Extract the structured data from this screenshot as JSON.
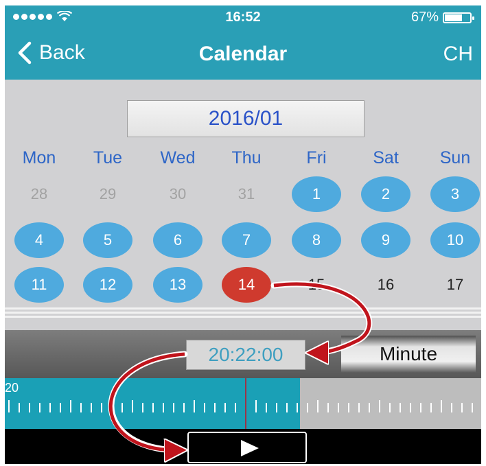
{
  "status_bar": {
    "signal_dots": 5,
    "time": "16:52",
    "battery_percent": "67%",
    "battery_level": 0.67
  },
  "nav": {
    "back_label": "Back",
    "title": "Calendar",
    "right_label": "CH"
  },
  "calendar": {
    "month": "2016/01",
    "weekdays": [
      "Mon",
      "Tue",
      "Wed",
      "Thu",
      "Fri",
      "Sat",
      "Sun"
    ],
    "weeks": [
      [
        {
          "d": "28",
          "s": "muted"
        },
        {
          "d": "29",
          "s": "muted"
        },
        {
          "d": "30",
          "s": "muted"
        },
        {
          "d": "31",
          "s": "muted"
        },
        {
          "d": "1",
          "s": "avail"
        },
        {
          "d": "2",
          "s": "avail"
        },
        {
          "d": "3",
          "s": "avail"
        }
      ],
      [
        {
          "d": "4",
          "s": "avail"
        },
        {
          "d": "5",
          "s": "avail"
        },
        {
          "d": "6",
          "s": "avail"
        },
        {
          "d": "7",
          "s": "avail"
        },
        {
          "d": "8",
          "s": "avail"
        },
        {
          "d": "9",
          "s": "avail"
        },
        {
          "d": "10",
          "s": "avail"
        }
      ],
      [
        {
          "d": "11",
          "s": "avail"
        },
        {
          "d": "12",
          "s": "avail"
        },
        {
          "d": "13",
          "s": "avail"
        },
        {
          "d": "14",
          "s": "sel"
        },
        {
          "d": "15",
          "s": "plain"
        },
        {
          "d": "16",
          "s": "plain"
        },
        {
          "d": "17",
          "s": "plain"
        }
      ]
    ],
    "colors": {
      "available": "#4faade",
      "selected": "#cf3a2e",
      "weekday": "#2e66c7",
      "header": "#2a9fb6"
    }
  },
  "timebar": {
    "time_value": "20:22:00",
    "unit_button": "Minute"
  },
  "timeline": {
    "hour_label": "20"
  },
  "playbar": {
    "play_icon": "play-icon"
  },
  "annotations": {
    "arrow_color": "#c0141c",
    "arrow_icon": "curved-arrow-icon"
  }
}
